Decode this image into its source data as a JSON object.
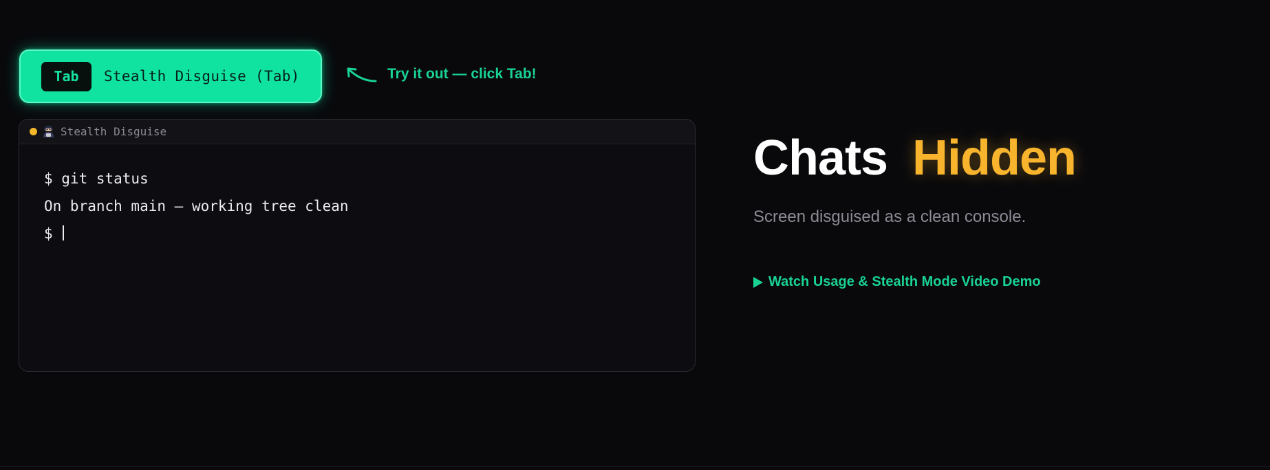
{
  "toggle": {
    "key_label": "Tab",
    "label": "Stealth Disguise (Tab)"
  },
  "hint": {
    "text": "Try it out — click Tab!",
    "icon": "curved-arrow-icon"
  },
  "terminal": {
    "title": "Stealth Disguise",
    "status_dot_color": "#f5b82a",
    "title_icon": "hacker-icon",
    "lines": [
      "$ git status",
      "On branch main — working tree clean",
      "$ "
    ]
  },
  "hero": {
    "headline_primary": "Chats",
    "headline_accent": "Hidden",
    "subheadline": "Screen disguised as a clean console.",
    "video_link": "Watch Usage & Stealth Mode Video Demo"
  },
  "colors": {
    "background": "#09090c",
    "accent_green": "#10e2a0",
    "accent_yellow": "#f8b42c",
    "muted_text": "#8b8b95"
  }
}
